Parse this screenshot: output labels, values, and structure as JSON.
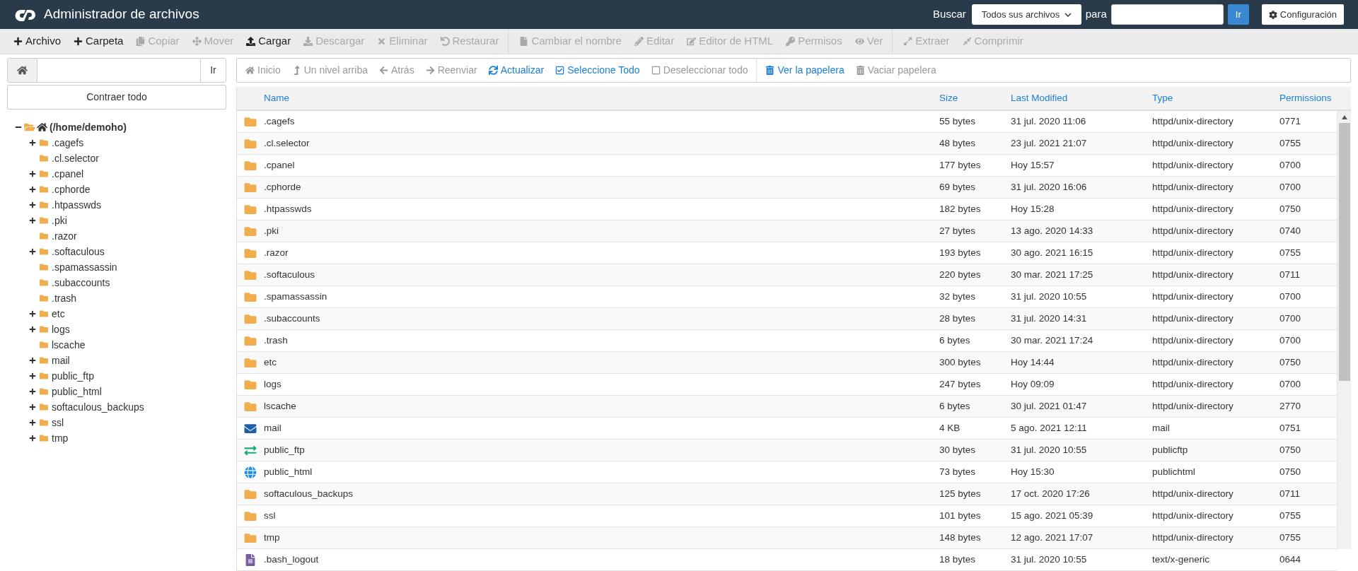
{
  "header": {
    "title": "Administrador de archivos",
    "search_label": "Buscar",
    "search_scope": "Todos sus archivos",
    "for_label": "para",
    "go_button": "Ir",
    "settings_button": "Configuración"
  },
  "toolbar": {
    "groups": [
      [
        {
          "label": "Archivo",
          "disabled": false
        },
        {
          "label": "Carpeta",
          "disabled": false
        },
        {
          "label": "Copiar",
          "disabled": true
        },
        {
          "label": "Mover",
          "disabled": true
        },
        {
          "label": "Cargar",
          "disabled": false
        },
        {
          "label": "Descargar",
          "disabled": true
        },
        {
          "label": "Eliminar",
          "disabled": true
        },
        {
          "label": "Restaurar",
          "disabled": true
        }
      ],
      [
        {
          "label": "Cambiar el nombre",
          "disabled": true
        },
        {
          "label": "Editar",
          "disabled": true
        },
        {
          "label": "Editor de HTML",
          "disabled": true
        },
        {
          "label": "Permisos",
          "disabled": true
        },
        {
          "label": "Ver",
          "disabled": true
        }
      ],
      [
        {
          "label": "Extraer",
          "disabled": true
        },
        {
          "label": "Comprimir",
          "disabled": true
        }
      ]
    ]
  },
  "path_bar": {
    "go_button": "Ir"
  },
  "collapse_button": "Contraer todo",
  "tree": {
    "label": "(/home/demoho)",
    "expanded": true,
    "children": [
      {
        "label": ".cagefs",
        "expandable": true
      },
      {
        "label": ".cl.selector",
        "expandable": false
      },
      {
        "label": ".cpanel",
        "expandable": true
      },
      {
        "label": ".cphorde",
        "expandable": true
      },
      {
        "label": ".htpasswds",
        "expandable": true
      },
      {
        "label": ".pki",
        "expandable": true
      },
      {
        "label": ".razor",
        "expandable": false
      },
      {
        "label": ".softaculous",
        "expandable": true
      },
      {
        "label": ".spamassassin",
        "expandable": false
      },
      {
        "label": ".subaccounts",
        "expandable": false
      },
      {
        "label": ".trash",
        "expandable": false
      },
      {
        "label": "etc",
        "expandable": true
      },
      {
        "label": "logs",
        "expandable": true
      },
      {
        "label": "lscache",
        "expandable": false
      },
      {
        "label": "mail",
        "expandable": true
      },
      {
        "label": "public_ftp",
        "expandable": true
      },
      {
        "label": "public_html",
        "expandable": true
      },
      {
        "label": "softaculous_backups",
        "expandable": true
      },
      {
        "label": "ssl",
        "expandable": true
      },
      {
        "label": "tmp",
        "expandable": true
      }
    ]
  },
  "nav": {
    "groups": [
      [
        {
          "label": "Inicio",
          "disabled": true
        },
        {
          "label": "Un nivel arriba",
          "disabled": true
        },
        {
          "label": "Atrás",
          "disabled": true
        },
        {
          "label": "Reenviar",
          "disabled": true
        },
        {
          "label": "Actualizar",
          "disabled": false
        },
        {
          "label": "Seleccione Todo",
          "disabled": false
        },
        {
          "label": "Deseleccionar todo",
          "disabled": true
        }
      ],
      [
        {
          "label": "Ver la papelera",
          "disabled": false
        },
        {
          "label": "Vaciar papelera",
          "disabled": true
        }
      ]
    ]
  },
  "table": {
    "columns": [
      "Name",
      "Size",
      "Last Modified",
      "Type",
      "Permissions"
    ],
    "rows": [
      {
        "kind": "folder",
        "name": ".cagefs",
        "size": "55 bytes",
        "modified": "31 jul. 2020 11:06",
        "type": "httpd/unix-directory",
        "permissions": "0771"
      },
      {
        "kind": "folder",
        "name": ".cl.selector",
        "size": "48 bytes",
        "modified": "23 jul. 2021 21:07",
        "type": "httpd/unix-directory",
        "permissions": "0755"
      },
      {
        "kind": "folder",
        "name": ".cpanel",
        "size": "177 bytes",
        "modified": "Hoy 15:57",
        "type": "httpd/unix-directory",
        "permissions": "0700"
      },
      {
        "kind": "folder",
        "name": ".cphorde",
        "size": "69 bytes",
        "modified": "31 jul. 2020 16:06",
        "type": "httpd/unix-directory",
        "permissions": "0700"
      },
      {
        "kind": "folder",
        "name": ".htpasswds",
        "size": "182 bytes",
        "modified": "Hoy 15:28",
        "type": "httpd/unix-directory",
        "permissions": "0750"
      },
      {
        "kind": "folder",
        "name": ".pki",
        "size": "27 bytes",
        "modified": "13 ago. 2020 14:33",
        "type": "httpd/unix-directory",
        "permissions": "0740"
      },
      {
        "kind": "folder",
        "name": ".razor",
        "size": "193 bytes",
        "modified": "30 ago. 2021 16:15",
        "type": "httpd/unix-directory",
        "permissions": "0755"
      },
      {
        "kind": "folder",
        "name": ".softaculous",
        "size": "220 bytes",
        "modified": "30 mar. 2021 17:25",
        "type": "httpd/unix-directory",
        "permissions": "0711"
      },
      {
        "kind": "folder",
        "name": ".spamassassin",
        "size": "32 bytes",
        "modified": "31 jul. 2020 10:55",
        "type": "httpd/unix-directory",
        "permissions": "0700"
      },
      {
        "kind": "folder",
        "name": ".subaccounts",
        "size": "28 bytes",
        "modified": "31 jul. 2020 14:31",
        "type": "httpd/unix-directory",
        "permissions": "0700"
      },
      {
        "kind": "folder",
        "name": ".trash",
        "size": "6 bytes",
        "modified": "30 mar. 2021 17:24",
        "type": "httpd/unix-directory",
        "permissions": "0700"
      },
      {
        "kind": "folder",
        "name": "etc",
        "size": "300 bytes",
        "modified": "Hoy 14:44",
        "type": "httpd/unix-directory",
        "permissions": "0750"
      },
      {
        "kind": "folder",
        "name": "logs",
        "size": "247 bytes",
        "modified": "Hoy 09:09",
        "type": "httpd/unix-directory",
        "permissions": "0700"
      },
      {
        "kind": "folder",
        "name": "lscache",
        "size": "6 bytes",
        "modified": "30 jul. 2021 01:47",
        "type": "httpd/unix-directory",
        "permissions": "2770"
      },
      {
        "kind": "mail",
        "name": "mail",
        "size": "4 KB",
        "modified": "5 ago. 2021 12:11",
        "type": "mail",
        "permissions": "0751"
      },
      {
        "kind": "ftp",
        "name": "public_ftp",
        "size": "30 bytes",
        "modified": "31 jul. 2020 10:55",
        "type": "publicftp",
        "permissions": "0750"
      },
      {
        "kind": "web",
        "name": "public_html",
        "size": "73 bytes",
        "modified": "Hoy 15:30",
        "type": "publichtml",
        "permissions": "0750"
      },
      {
        "kind": "folder",
        "name": "softaculous_backups",
        "size": "125 bytes",
        "modified": "17 oct. 2020 17:26",
        "type": "httpd/unix-directory",
        "permissions": "0711"
      },
      {
        "kind": "folder",
        "name": "ssl",
        "size": "101 bytes",
        "modified": "15 ago. 2021 05:39",
        "type": "httpd/unix-directory",
        "permissions": "0755"
      },
      {
        "kind": "folder",
        "name": "tmp",
        "size": "148 bytes",
        "modified": "12 ago. 2021 17:07",
        "type": "httpd/unix-directory",
        "permissions": "0755"
      },
      {
        "kind": "file",
        "name": ".bash_logout",
        "size": "18 bytes",
        "modified": "31 jul. 2020 10:55",
        "type": "text/x-generic",
        "permissions": "0644"
      }
    ]
  }
}
